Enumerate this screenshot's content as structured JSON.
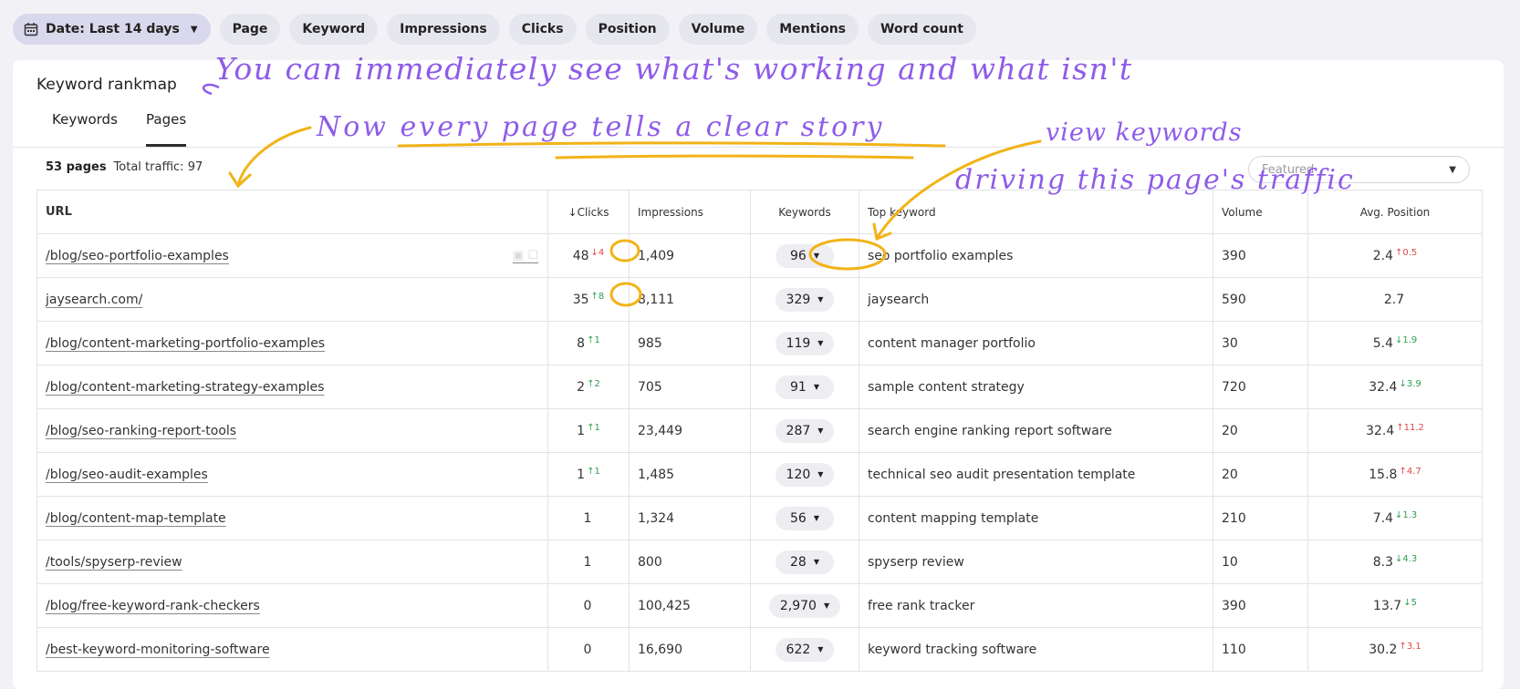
{
  "filters": {
    "date": "Date: Last 14 days",
    "chips": [
      "Page",
      "Keyword",
      "Impressions",
      "Clicks",
      "Position",
      "Volume",
      "Mentions",
      "Word count"
    ]
  },
  "card": {
    "title": "Keyword rankmap",
    "tabs": [
      "Keywords",
      "Pages"
    ],
    "summary": {
      "pages": "53 pages",
      "traffic": "Total traffic: 97"
    },
    "sort_select": "Featured"
  },
  "table": {
    "headers": {
      "url": "URL",
      "clicks": "Clicks",
      "impressions": "Impressions",
      "keywords": "Keywords",
      "top_keyword": "Top keyword",
      "volume": "Volume",
      "avg_position": "Avg. Position"
    },
    "rows": [
      {
        "url": "/blog/seo-portfolio-examples",
        "clicks": "48",
        "clicks_delta": "↓4",
        "impressions": "1,409",
        "keywords": "96",
        "top_keyword": "seo portfolio examples",
        "volume": "390",
        "position": "2.4",
        "position_delta": "↑0.5"
      },
      {
        "url": "jaysearch.com/",
        "clicks": "35",
        "clicks_delta": "↑8",
        "impressions": "8,111",
        "keywords": "329",
        "top_keyword": "jaysearch",
        "volume": "590",
        "position": "2.7",
        "position_delta": ""
      },
      {
        "url": "/blog/content-marketing-portfolio-examples",
        "clicks": "8",
        "clicks_delta": "↑1",
        "impressions": "985",
        "keywords": "119",
        "top_keyword": "content manager portfolio",
        "volume": "30",
        "position": "5.4",
        "position_delta": "↓1.9"
      },
      {
        "url": "/blog/content-marketing-strategy-examples",
        "clicks": "2",
        "clicks_delta": "↑2",
        "impressions": "705",
        "keywords": "91",
        "top_keyword": "sample content strategy",
        "volume": "720",
        "position": "32.4",
        "position_delta": "↓3.9"
      },
      {
        "url": "/blog/seo-ranking-report-tools",
        "clicks": "1",
        "clicks_delta": "↑1",
        "impressions": "23,449",
        "keywords": "287",
        "top_keyword": "search engine ranking report software",
        "volume": "20",
        "position": "32.4",
        "position_delta": "↑11.2"
      },
      {
        "url": "/blog/seo-audit-examples",
        "clicks": "1",
        "clicks_delta": "↑1",
        "impressions": "1,485",
        "keywords": "120",
        "top_keyword": "technical seo audit presentation template",
        "volume": "20",
        "position": "15.8",
        "position_delta": "↑4.7"
      },
      {
        "url": "/blog/content-map-template",
        "clicks": "1",
        "clicks_delta": "",
        "impressions": "1,324",
        "keywords": "56",
        "top_keyword": "content mapping template",
        "volume": "210",
        "position": "7.4",
        "position_delta": "↓1.3"
      },
      {
        "url": "/tools/spyserp-review",
        "clicks": "1",
        "clicks_delta": "",
        "impressions": "800",
        "keywords": "28",
        "top_keyword": "spyserp review",
        "volume": "10",
        "position": "8.3",
        "position_delta": "↓4.3"
      },
      {
        "url": "/blog/free-keyword-rank-checkers",
        "clicks": "0",
        "clicks_delta": "",
        "impressions": "100,425",
        "keywords": "2,970",
        "top_keyword": "free rank tracker",
        "volume": "390",
        "position": "13.7",
        "position_delta": "↓5"
      },
      {
        "url": "/best-keyword-monitoring-software",
        "clicks": "0",
        "clicks_delta": "",
        "impressions": "16,690",
        "keywords": "622",
        "top_keyword": "keyword tracking software",
        "volume": "110",
        "position": "30.2",
        "position_delta": "↑3.1"
      }
    ]
  },
  "annotations": {
    "line1": "You can immediately see what's working and what isn't",
    "line2": "Now every page tells a clear story",
    "line3": "view keywords",
    "line4": "driving this page's traffic"
  },
  "colors": {
    "annotation": "#8e5ce8",
    "highlight": "#f2b318",
    "positive": "#2ea04f",
    "negative": "#e04848"
  }
}
